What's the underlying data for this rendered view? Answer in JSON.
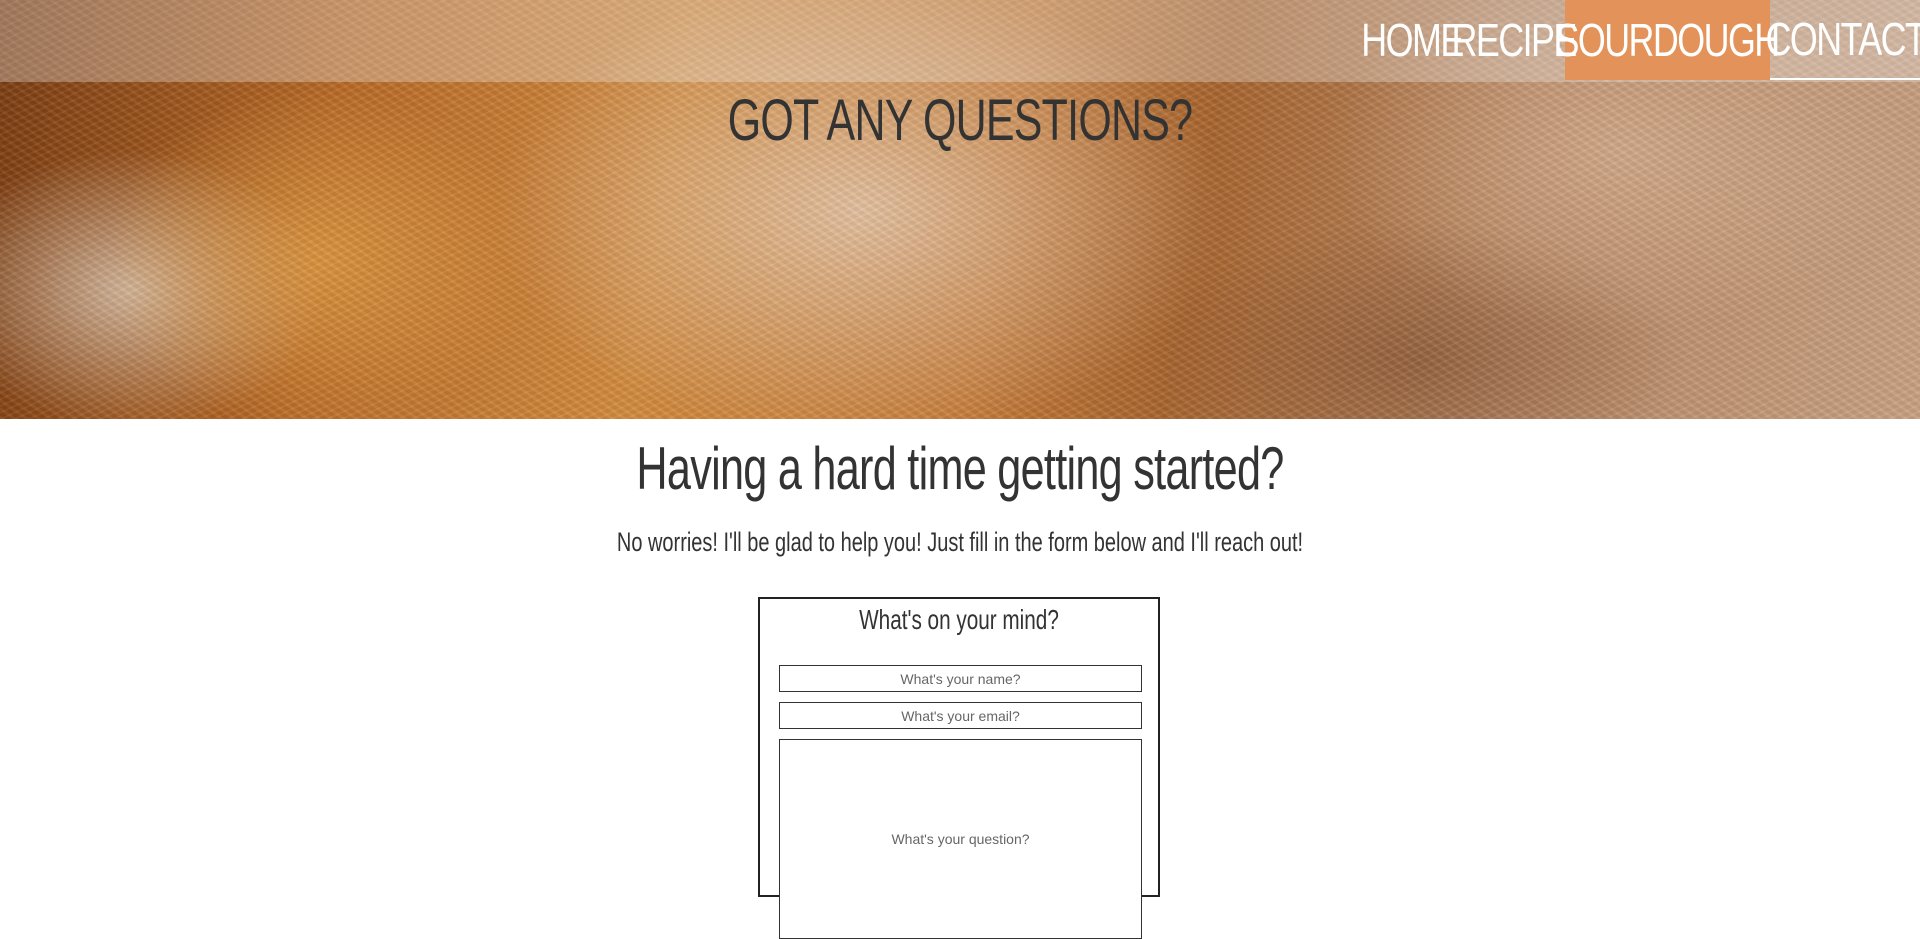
{
  "nav": {
    "items": [
      {
        "label": "HOME"
      },
      {
        "label": "RECIPE"
      },
      {
        "label": "SOURDOUGH"
      },
      {
        "label": "CONTACT"
      }
    ],
    "active_highlight_color": "#e3935a"
  },
  "hero": {
    "title": "GOT ANY QUESTIONS?",
    "image": "bread-loaf-image"
  },
  "intro": {
    "headline": "Having a hard time getting started?",
    "subline": "No worries! I'll be glad to help you! Just fill in the form below and I'll reach out!"
  },
  "form": {
    "title": "What's on your mind?",
    "name_placeholder": "What's your name?",
    "email_placeholder": "What's your email?",
    "question_placeholder": "What's your question?"
  }
}
